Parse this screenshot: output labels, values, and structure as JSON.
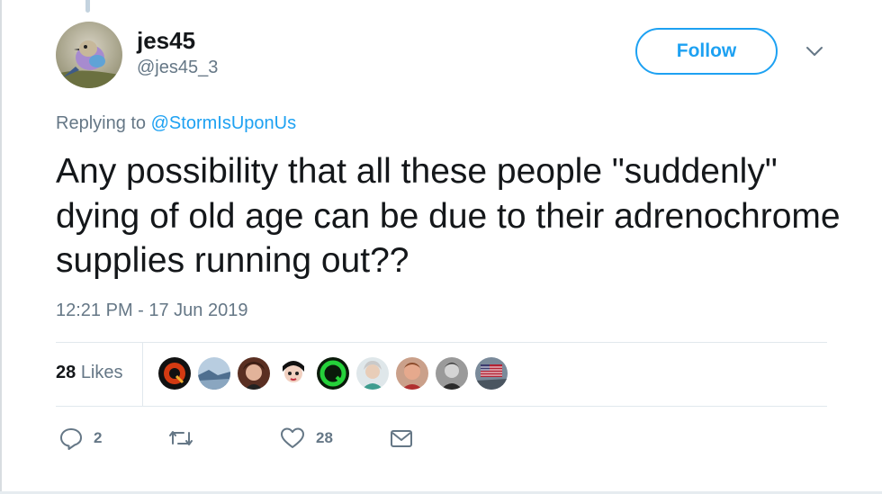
{
  "user": {
    "name": "jes45",
    "handle": "@jes45_3",
    "follow_label": "Follow"
  },
  "reply": {
    "prefix": "Replying to ",
    "mention": "@StormIsUponUs"
  },
  "tweet": {
    "text": "Any possibility that all these people \"suddenly\" dying of old age can be due to their adrenochrome supplies running out??",
    "timestamp": "12:21 PM - 17 Jun 2019"
  },
  "stats": {
    "likes_count": "28",
    "likes_label": "Likes"
  },
  "actions": {
    "reply_count": "2",
    "like_count": "28"
  },
  "colors": {
    "accent": "#1da1f2",
    "secondary_text": "#657786",
    "primary_text": "#14171a"
  },
  "icons": [
    "reply-icon",
    "retweet-icon",
    "heart-icon",
    "envelope-icon",
    "chevron-down-icon"
  ]
}
